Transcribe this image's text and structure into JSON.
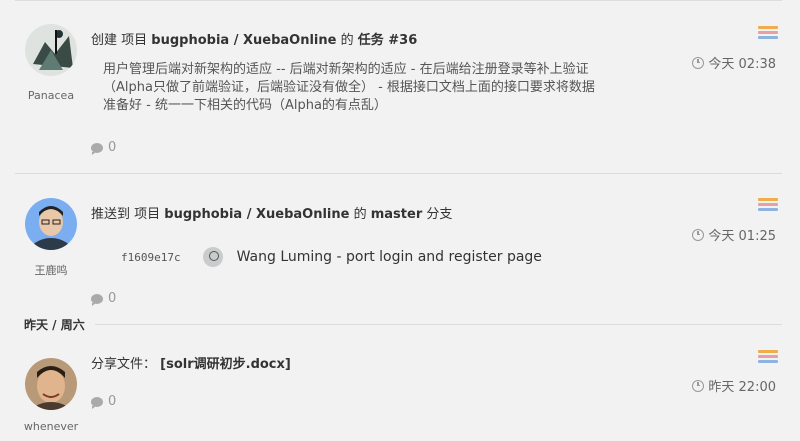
{
  "colors": {
    "background": "#f2f2f2",
    "flag": [
      "#f0ad4e",
      "#5b9bd5",
      "#a8c97f"
    ]
  },
  "items": [
    {
      "user": "Panacea",
      "title_prefix": "创建 项目",
      "project": "bugphobia / XuebaOnline",
      "title_mid": "的",
      "title_suffix": "任务 #36",
      "time": "今天 02:38",
      "description": "用户管理后端对新架构的适应 -- 后端对新架构的适应 - 在后端给注册登录等补上验证（Alpha只做了前端验证，后端验证没有做全） - 根据接口文档上面的接口要求将数据准备好 - 统一一下相关的代码（Alpha的有点乱）",
      "comments": "0"
    },
    {
      "user": "王鹿鸣",
      "title_prefix": "推送到 项目",
      "project": "bugphobia / XuebaOnline",
      "title_mid": "的",
      "branch": "master",
      "title_suffix": "分支",
      "time": "今天 01:25",
      "commit_sha": "f1609e17c",
      "commit_message": "Wang Luming - port login and register page",
      "comments": "0"
    },
    {
      "user": "whenever",
      "title_prefix": "分享文件：",
      "file": "[solr调研初步.docx]",
      "time": "昨天 22:00",
      "comments": "0"
    }
  ],
  "day_header": "昨天 / 周六"
}
